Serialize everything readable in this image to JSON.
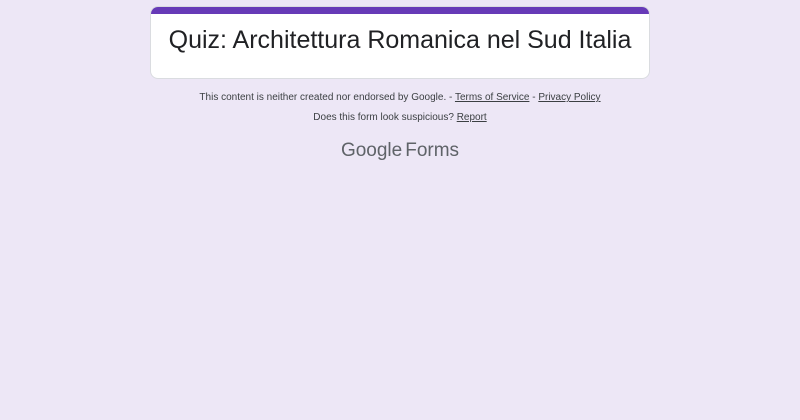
{
  "form": {
    "title": "Quiz: Architettura Romanica nel Sud Italia",
    "accent_color": "#673ab7",
    "background_color": "#ede7f6"
  },
  "footer": {
    "disclaimer": "This content is neither created nor endorsed by Google.",
    "sep1": " - ",
    "terms_label": "Terms of Service",
    "sep2": " - ",
    "privacy_label": "Privacy Policy",
    "suspicious_text": "Does this form look suspicious? ",
    "report_label": "Report"
  },
  "brand": {
    "google": "Google",
    "product": "Forms"
  }
}
